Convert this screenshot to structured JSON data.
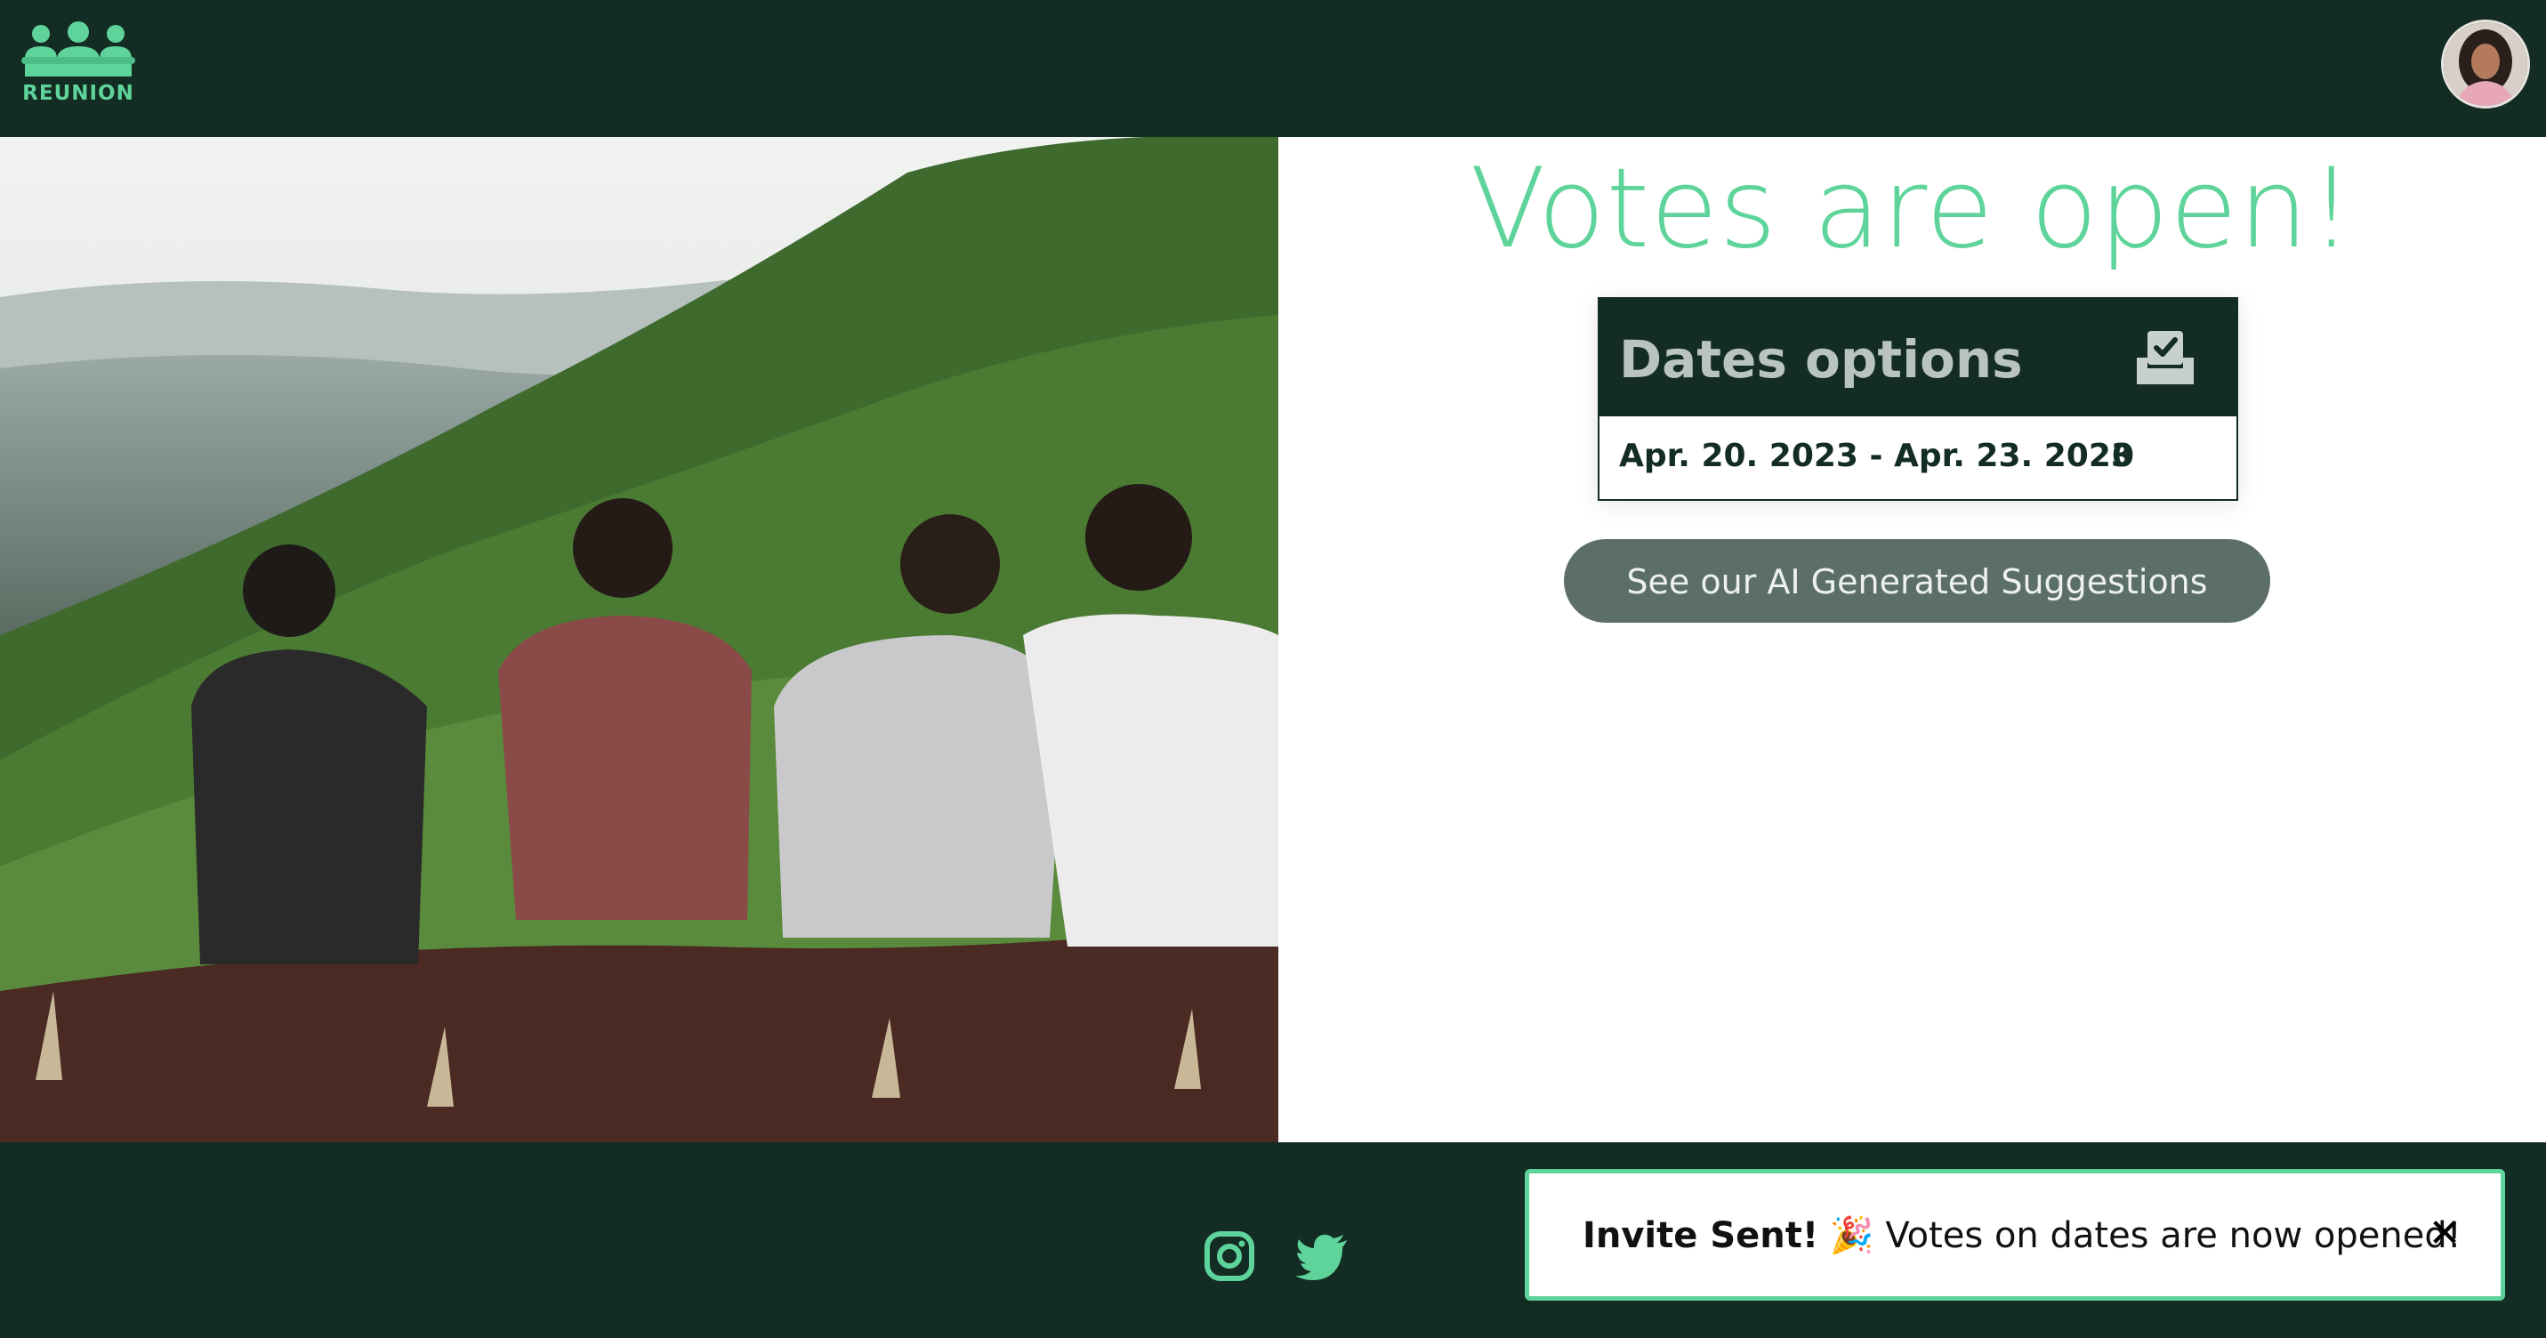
{
  "brand": {
    "name": "REUNION",
    "logo_icon": "people-group-icon",
    "accent_color": "#5fd49a",
    "dark_color": "#132c24"
  },
  "header": {
    "avatar_icon": "user-avatar"
  },
  "hero": {
    "image_icon": "friends-on-mountain-photo"
  },
  "main": {
    "title": "Votes are open!",
    "dates_card": {
      "heading": "Dates options",
      "heading_icon": "ballot-box-check-icon",
      "rows": [
        {
          "range": "Apr. 20. 2023 - Apr. 23. 2023",
          "votes": "0"
        }
      ]
    },
    "ai_button_label": "See our AI Generated Suggestions"
  },
  "footer": {
    "social": [
      {
        "icon": "instagram-icon"
      },
      {
        "icon": "twitter-icon"
      }
    ]
  },
  "toast": {
    "strong": "Invite Sent!",
    "emoji": "🎉",
    "message": "Votes on dates are now opened!",
    "close_label": "✕"
  }
}
